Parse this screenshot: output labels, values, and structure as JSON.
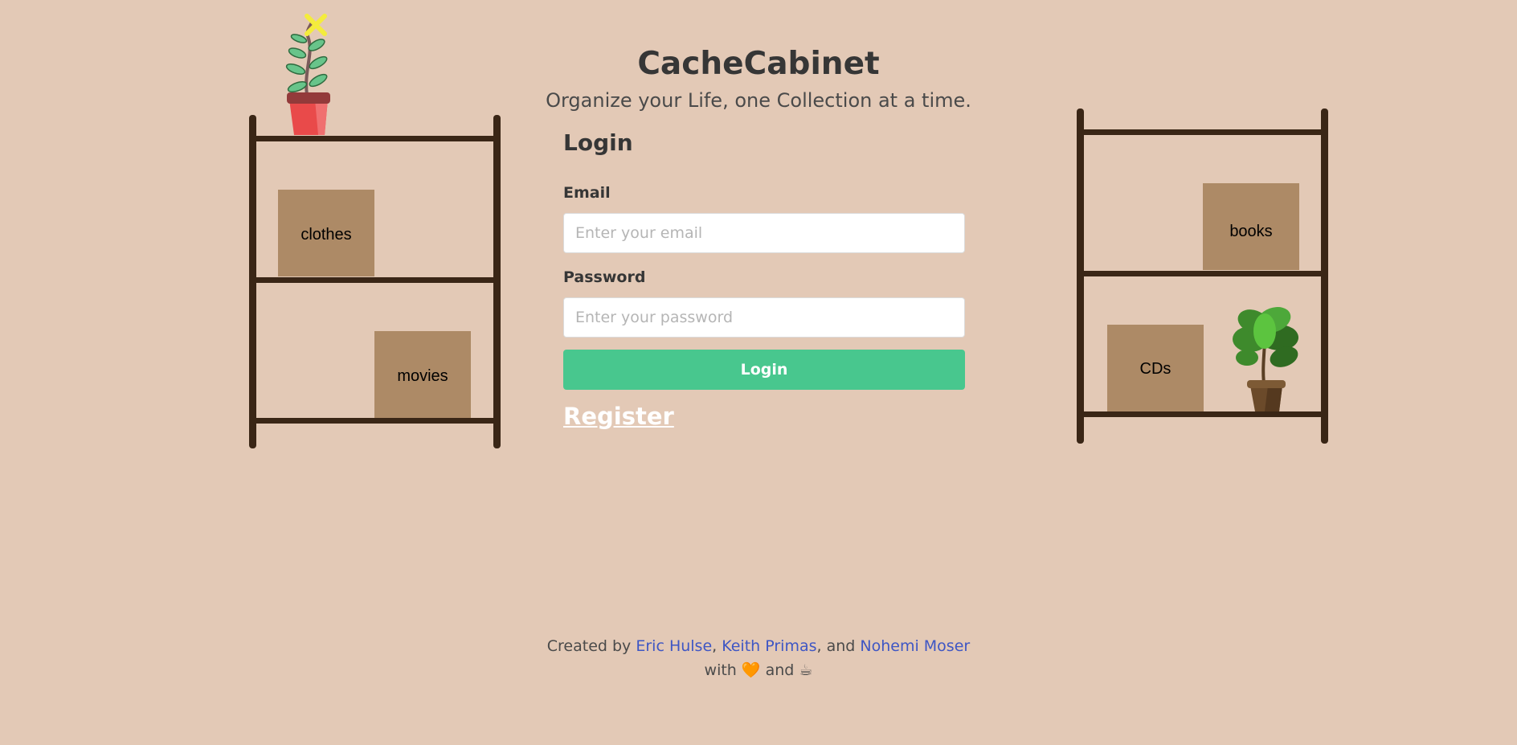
{
  "header": {
    "title": "CacheCabinet",
    "subtitle": "Organize your Life, one Collection at a time."
  },
  "login_form": {
    "heading": "Login",
    "email_label": "Email",
    "email_placeholder": "Enter your email",
    "email_value": "",
    "password_label": "Password",
    "password_placeholder": "Enter your password",
    "password_value": "",
    "login_button": "Login",
    "register_link": "Register"
  },
  "shelves": {
    "left": {
      "boxes": [
        "clothes",
        "movies"
      ]
    },
    "right": {
      "boxes": [
        "books",
        "CDs"
      ]
    }
  },
  "footer": {
    "created_by": "Created by",
    "author1": "Eric Hulse",
    "sep1": ",",
    "author2": "Keith Primas",
    "sep2": ", and",
    "author3": "Nohemi Moser",
    "with": "with",
    "heart": "🧡",
    "and": "and",
    "coffee": "☕"
  },
  "colors": {
    "background": "#e3c9b6",
    "primary_button": "#48c78e",
    "link": "#3e56c4",
    "shelf_wood": "#3a2616",
    "box": "#ad8a66"
  }
}
